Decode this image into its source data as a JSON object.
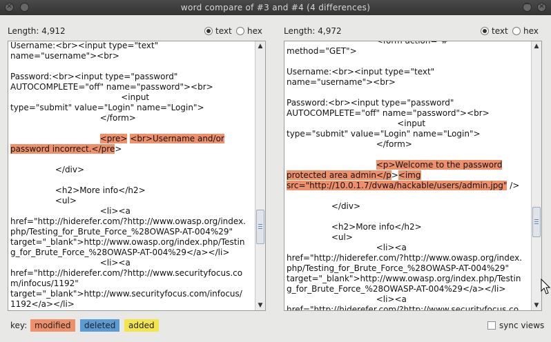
{
  "window": {
    "title": "word compare of #3 and #4  (4 differences)"
  },
  "left": {
    "length_label": "Length: 4,912",
    "radio_text": "text",
    "radio_hex": "hex",
    "lines": [
      [
        {
          "t": "Username:<br><input type=\"text\""
        }
      ],
      [
        {
          "t": "name=\"username\"><br>"
        }
      ],
      [
        {
          "t": ""
        }
      ],
      [
        {
          "t": "Password:<br><input type=\"password\""
        }
      ],
      [
        {
          "t": "AUTOCOMPLETE=\"off\" name=\"password\"><br>"
        }
      ],
      [
        {
          "t": "                                          <input"
        }
      ],
      [
        {
          "t": "type=\"submit\" value=\"Login\" name=\"Login\">"
        }
      ],
      [
        {
          "t": "                                  </form>"
        }
      ],
      [
        {
          "t": ""
        }
      ],
      [
        {
          "t": "                                  "
        },
        {
          "t": "<pre>",
          "m": 1
        },
        {
          "t": " "
        },
        {
          "t": "<br>Username and/or",
          "m": 1
        }
      ],
      [
        {
          "t": "password incorrect.</pre",
          "m": 1
        },
        {
          "t": ">"
        }
      ],
      [
        {
          "t": ""
        }
      ],
      [
        {
          "t": "                 </div>"
        }
      ],
      [
        {
          "t": ""
        }
      ],
      [
        {
          "t": "                 <h2>More info</h2>"
        }
      ],
      [
        {
          "t": "                 <ul>"
        }
      ],
      [
        {
          "t": "                                  <li><a"
        }
      ],
      [
        {
          "t": "href=\"http://hiderefer.com/?http://www.owasp.org/index."
        }
      ],
      [
        {
          "t": "php/Testing_for_Brute_Force_%28OWASP-AT-004%29\""
        }
      ],
      [
        {
          "t": "target=\"_blank\">http://www.owasp.org/index.php/Testin"
        }
      ],
      [
        {
          "t": "g_for_Brute_Force_%28OWASP-AT-004%29</a></li>"
        }
      ],
      [
        {
          "t": "                                  <li><a"
        }
      ],
      [
        {
          "t": "href=\"http://hiderefer.com/?http://www.securityfocus.co"
        }
      ],
      [
        {
          "t": "m/infocus/1192\""
        }
      ],
      [
        {
          "t": "target=\"_blank\">http://www.securityfocus.com/infocus/"
        }
      ],
      [
        {
          "t": "1192</a></li>"
        }
      ],
      [
        {
          "t": "                                  <li><a"
        }
      ]
    ]
  },
  "right": {
    "length_label": "Length: 4,972",
    "radio_text": "text",
    "radio_hex": "hex",
    "lines": [
      [
        {
          "t": "                                  <form action=\"#\""
        }
      ],
      [
        {
          "t": "method=\"GET\">"
        }
      ],
      [
        {
          "t": ""
        }
      ],
      [
        {
          "t": "Username:<br><input type=\"text\""
        }
      ],
      [
        {
          "t": "name=\"username\"><br>"
        }
      ],
      [
        {
          "t": ""
        }
      ],
      [
        {
          "t": "Password:<br><input type=\"password\""
        }
      ],
      [
        {
          "t": "AUTOCOMPLETE=\"off\" name=\"password\"><br>"
        }
      ],
      [
        {
          "t": "                                          <input"
        }
      ],
      [
        {
          "t": "type=\"submit\" value=\"Login\" name=\"Login\">"
        }
      ],
      [
        {
          "t": "                                  </form>"
        }
      ],
      [
        {
          "t": ""
        }
      ],
      [
        {
          "t": "                                  "
        },
        {
          "t": "<p>Welcome to the password",
          "m": 1
        }
      ],
      [
        {
          "t": "protected area admin</p",
          "m": 1
        },
        {
          "t": ">"
        },
        {
          "t": "<img",
          "m": 1
        }
      ],
      [
        {
          "t": "src=\"http://10.0.1.7/dvwa/hackable/users/admin.jpg\"",
          "m": 1
        },
        {
          "t": " />"
        }
      ],
      [
        {
          "t": ""
        }
      ],
      [
        {
          "t": "                 </div>"
        }
      ],
      [
        {
          "t": ""
        }
      ],
      [
        {
          "t": "                 <h2>More info</h2>"
        }
      ],
      [
        {
          "t": "                 <ul>"
        }
      ],
      [
        {
          "t": "                                  <li><a"
        }
      ],
      [
        {
          "t": "href=\"http://hiderefer.com/?http://www.owasp.org/index."
        }
      ],
      [
        {
          "t": "php/Testing_for_Brute_Force_%28OWASP-AT-004%29\""
        }
      ],
      [
        {
          "t": "target=\"_blank\">http://www.owasp.org/index.php/Testin"
        }
      ],
      [
        {
          "t": "g_for_Brute_Force_%28OWASP-AT-004%29</a></li>"
        }
      ],
      [
        {
          "t": "                                  <li><a"
        }
      ],
      [
        {
          "t": "href=\"http://hiderefer.com/?http://www.securityfocus.co"
        }
      ]
    ]
  },
  "footer": {
    "key_label": "key:",
    "modified": "modified",
    "deleted": "deleted",
    "added": "added",
    "sync_label": "sync views"
  },
  "colors": {
    "modified": "#f0906a",
    "deleted": "#5b9bd5",
    "added": "#f2e64b"
  }
}
